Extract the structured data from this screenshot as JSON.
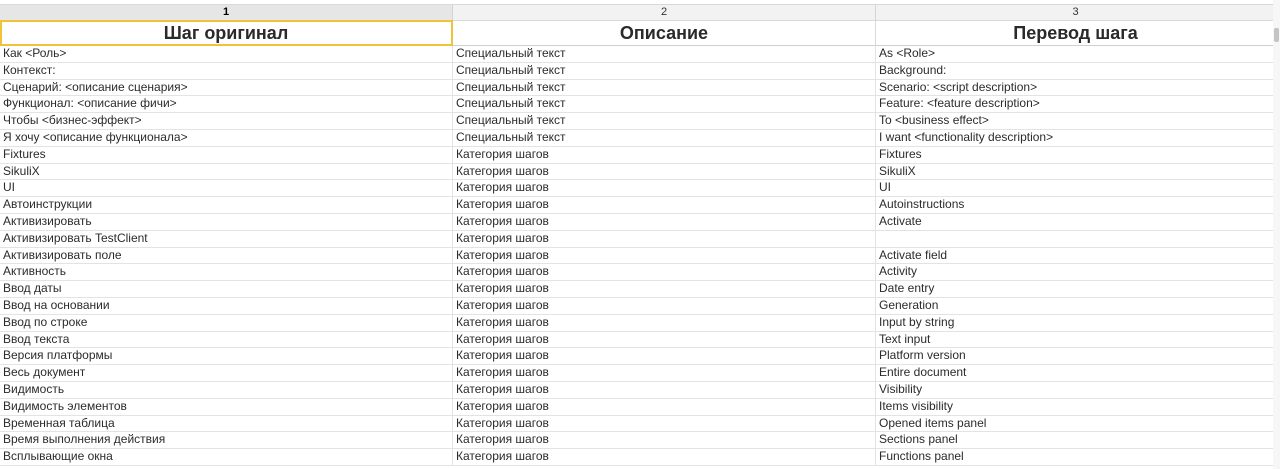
{
  "columns": {
    "numbers": [
      "1",
      "2",
      "3"
    ],
    "headers": [
      "Шаг оригинал",
      "Описание",
      "Перевод шага"
    ]
  },
  "rows": [
    [
      "Как <Роль>",
      "Специальный текст",
      "As <Role>"
    ],
    [
      "Контекст:",
      "Специальный текст",
      "Background:"
    ],
    [
      "Сценарий: <описание сценария>",
      "Специальный текст",
      "Scenario: <script description>"
    ],
    [
      "Функционал: <описание фичи>",
      "Специальный текст",
      "Feature: <feature description>"
    ],
    [
      "Чтобы <бизнес-эффект>",
      "Специальный текст",
      "To <business effect>"
    ],
    [
      "Я хочу <описание функционала>",
      "Специальный текст",
      "I want <functionality description>"
    ],
    [
      "Fixtures",
      "Категория шагов",
      "Fixtures"
    ],
    [
      "SikuliX",
      "Категория шагов",
      "SikuliX"
    ],
    [
      "UI",
      "Категория шагов",
      "UI"
    ],
    [
      "Автоинструкции",
      "Категория шагов",
      "Autoinstructions"
    ],
    [
      "Активизировать",
      "Категория шагов",
      "Activate"
    ],
    [
      "Активизировать TestClient",
      "Категория шагов",
      ""
    ],
    [
      "Активизировать поле",
      "Категория шагов",
      "Activate field"
    ],
    [
      "Активность",
      "Категория шагов",
      "Activity"
    ],
    [
      "Ввод даты",
      "Категория шагов",
      "Date entry"
    ],
    [
      "Ввод на основании",
      "Категория шагов",
      "Generation"
    ],
    [
      "Ввод по строке",
      "Категория шагов",
      "Input by string"
    ],
    [
      "Ввод текста",
      "Категория шагов",
      "Text input"
    ],
    [
      "Версия платформы",
      "Категория шагов",
      "Platform version"
    ],
    [
      "Весь документ",
      "Категория шагов",
      "Entire document"
    ],
    [
      "Видимость",
      "Категория шагов",
      "Visibility"
    ],
    [
      "Видимость элементов",
      "Категория шагов",
      "Items visibility"
    ],
    [
      "Временная таблица",
      "Категория шагов",
      "Opened items panel"
    ],
    [
      "Время выполнения действия",
      "Категория шагов",
      "Sections panel"
    ],
    [
      "Всплывающие окна",
      "Категория шагов",
      "Functions panel"
    ]
  ]
}
